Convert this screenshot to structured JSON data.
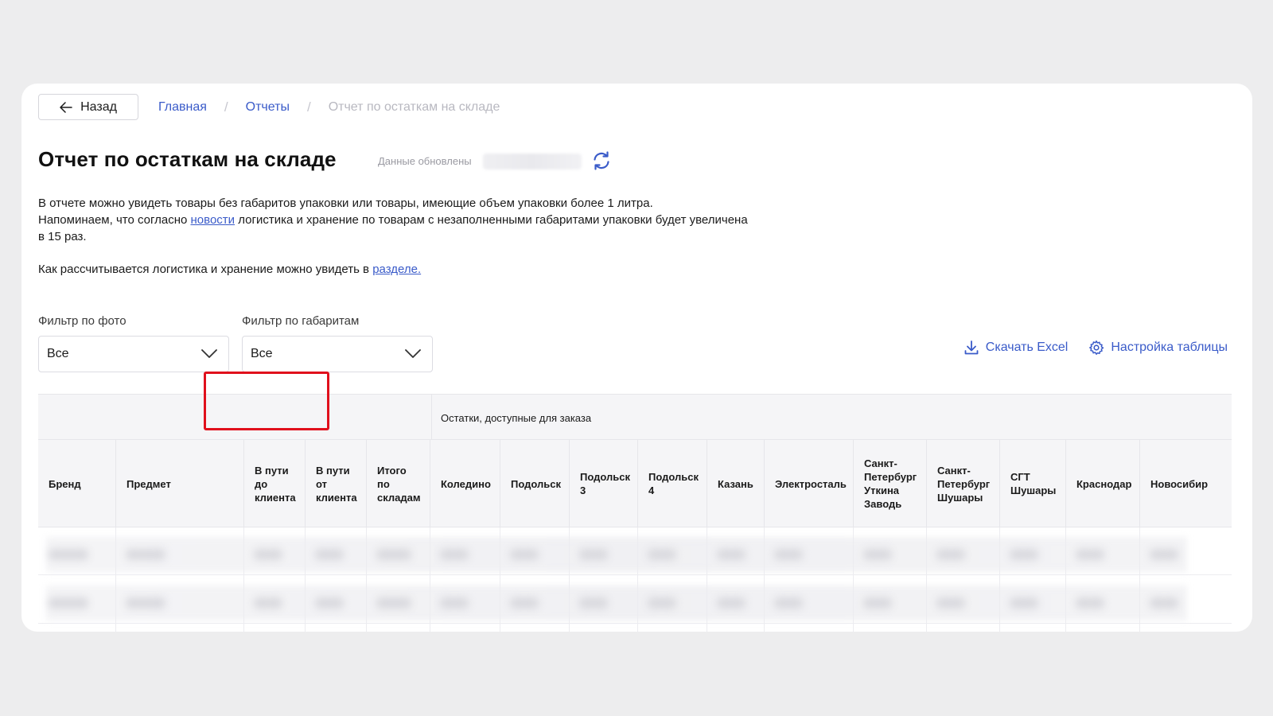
{
  "nav": {
    "back_label": "Назад",
    "breadcrumbs": [
      "Главная",
      "Отчеты",
      "Отчет по остаткам на складе"
    ],
    "separator": "/"
  },
  "header": {
    "title": "Отчет по остаткам на складе",
    "updated_label": "Данные обновлены"
  },
  "description": {
    "line1": "В отчете можно увидеть товары без габаритов упаковки или товары, имеющие объем упаковки более 1 литра.",
    "line2_prefix": "Напоминаем, что согласно ",
    "line2_link": "новости",
    "line2_suffix": " логистика и хранение по товарам с незаполненными габаритами упаковки будет увеличена в 15 раз.",
    "line3_prefix": "Как рассчитывается логистика и хранение можно увидеть в ",
    "line3_link": "разделе."
  },
  "filters": {
    "photo": {
      "label": "Фильтр по фото",
      "value": "Все"
    },
    "dimensions": {
      "label": "Фильтр по габаритам",
      "value": "Все"
    }
  },
  "actions": {
    "download": "Скачать Excel",
    "settings": "Настройка таблицы"
  },
  "table": {
    "group_header": "Остатки, доступные для заказа",
    "columns": [
      "Бренд",
      "Предмет",
      "В пути\nдо\nклиента",
      "В пути\nот\nклиента",
      "Итого\nпо\nскладам",
      "Коледино",
      "Подольск",
      "Подольск\n3",
      "Подольск\n4",
      "Казань",
      "Электросталь",
      "Санкт-\nПетербург\nУткина\nЗаводь",
      "Санкт-\nПетербург\nШушары",
      "СГТ\nШушары",
      "Краснодар",
      "Новосибир"
    ]
  },
  "colors": {
    "link": "#3a5bc9",
    "highlight": "#e0101c",
    "header_bg": "#f5f5f7"
  }
}
